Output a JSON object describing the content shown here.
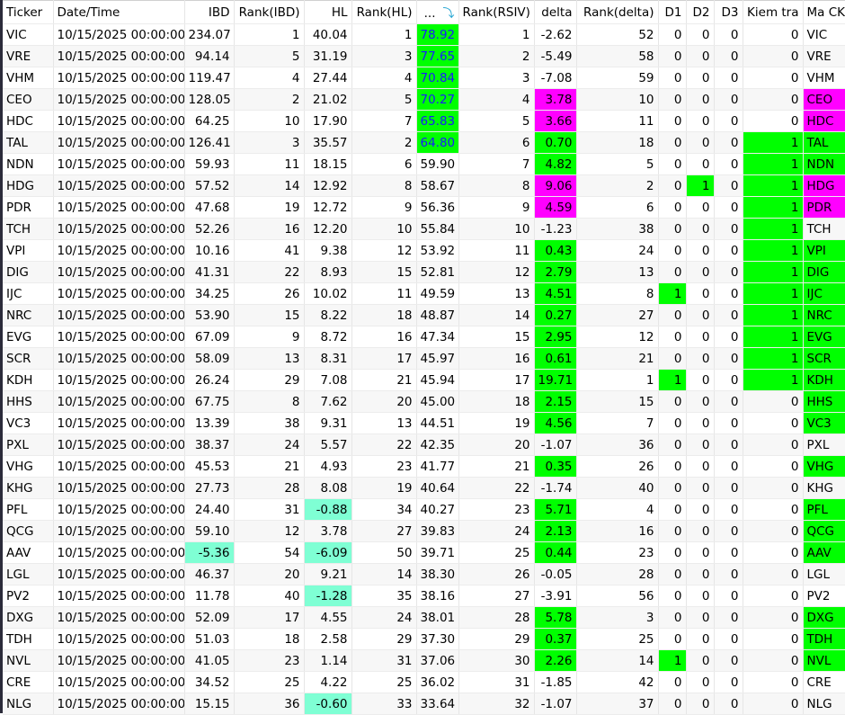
{
  "columns": [
    {
      "label": "Ticker",
      "align": "l",
      "w": 56
    },
    {
      "label": "Date/Time",
      "align": "l",
      "w": 146
    },
    {
      "label": "IBD",
      "align": "r",
      "w": 55
    },
    {
      "label": "Rank(IBD)",
      "align": "r",
      "w": 78
    },
    {
      "label": "HL",
      "align": "r",
      "w": 53
    },
    {
      "label": "Rank(HL)",
      "align": "r",
      "w": 72
    },
    {
      "label": "...",
      "align": "r",
      "w": 47,
      "sort_icon": "sort-descending-icon"
    },
    {
      "label": "Rank(RSIV)",
      "align": "r",
      "w": 84
    },
    {
      "label": "delta",
      "align": "r",
      "w": 47
    },
    {
      "label": "Rank(delta)",
      "align": "r",
      "w": 91
    },
    {
      "label": "D1",
      "align": "r",
      "w": 31
    },
    {
      "label": "D2",
      "align": "r",
      "w": 31
    },
    {
      "label": "D3",
      "align": "r",
      "w": 32
    },
    {
      "label": "Kiem tra",
      "align": "r",
      "w": 67
    },
    {
      "label": "Ma CK",
      "align": "l",
      "w": 47
    }
  ],
  "colors": {
    "green": "#00ff00",
    "greenblue": "#00ff00",
    "magenta": "#ff00ff",
    "aqua": "#7fffd4"
  },
  "rows": [
    {
      "v": [
        "VIC",
        "10/15/2025 00:00:00",
        "234.07",
        "1",
        "40.04",
        "1",
        "78.92",
        "1",
        "-2.62",
        "52",
        "0",
        "0",
        "0",
        "0",
        "VIC"
      ],
      "hl": {
        "6": "greenblue"
      }
    },
    {
      "v": [
        "VRE",
        "10/15/2025 00:00:00",
        "94.14",
        "5",
        "31.19",
        "3",
        "77.65",
        "2",
        "-5.49",
        "58",
        "0",
        "0",
        "0",
        "0",
        "VRE"
      ],
      "hl": {
        "6": "greenblue"
      }
    },
    {
      "v": [
        "VHM",
        "10/15/2025 00:00:00",
        "119.47",
        "4",
        "27.44",
        "4",
        "70.84",
        "3",
        "-7.08",
        "59",
        "0",
        "0",
        "0",
        "0",
        "VHM"
      ],
      "hl": {
        "6": "greenblue"
      }
    },
    {
      "v": [
        "CEO",
        "10/15/2025 00:00:00",
        "128.05",
        "2",
        "21.02",
        "5",
        "70.27",
        "4",
        "3.78",
        "10",
        "0",
        "0",
        "0",
        "0",
        "CEO"
      ],
      "hl": {
        "6": "greenblue",
        "8": "magenta",
        "14": "magenta"
      }
    },
    {
      "v": [
        "HDC",
        "10/15/2025 00:00:00",
        "64.25",
        "10",
        "17.90",
        "7",
        "65.83",
        "5",
        "3.66",
        "11",
        "0",
        "0",
        "0",
        "0",
        "HDC"
      ],
      "hl": {
        "6": "greenblue",
        "8": "magenta",
        "14": "magenta"
      }
    },
    {
      "v": [
        "TAL",
        "10/15/2025 00:00:00",
        "126.41",
        "3",
        "35.57",
        "2",
        "64.80",
        "6",
        "0.70",
        "18",
        "0",
        "0",
        "0",
        "1",
        "TAL"
      ],
      "hl": {
        "6": "greenblue",
        "8": "green",
        "13": "green",
        "14": "green"
      }
    },
    {
      "v": [
        "NDN",
        "10/15/2025 00:00:00",
        "59.93",
        "11",
        "18.15",
        "6",
        "59.90",
        "7",
        "4.82",
        "5",
        "0",
        "0",
        "0",
        "1",
        "NDN"
      ],
      "hl": {
        "8": "green",
        "13": "green",
        "14": "green"
      }
    },
    {
      "v": [
        "HDG",
        "10/15/2025 00:00:00",
        "57.52",
        "14",
        "12.92",
        "8",
        "58.67",
        "8",
        "9.06",
        "2",
        "0",
        "1",
        "0",
        "1",
        "HDG"
      ],
      "hl": {
        "8": "magenta",
        "11": "green",
        "13": "green",
        "14": "magenta"
      }
    },
    {
      "v": [
        "PDR",
        "10/15/2025 00:00:00",
        "47.68",
        "19",
        "12.72",
        "9",
        "56.36",
        "9",
        "4.59",
        "6",
        "0",
        "0",
        "0",
        "1",
        "PDR"
      ],
      "hl": {
        "8": "magenta",
        "13": "green",
        "14": "magenta"
      }
    },
    {
      "v": [
        "TCH",
        "10/15/2025 00:00:00",
        "52.26",
        "16",
        "12.20",
        "10",
        "55.84",
        "10",
        "-1.23",
        "38",
        "0",
        "0",
        "0",
        "1",
        "TCH"
      ],
      "hl": {
        "13": "green"
      }
    },
    {
      "v": [
        "VPI",
        "10/15/2025 00:00:00",
        "10.16",
        "41",
        "9.38",
        "12",
        "53.92",
        "11",
        "0.43",
        "24",
        "0",
        "0",
        "0",
        "1",
        "VPI"
      ],
      "hl": {
        "8": "green",
        "13": "green",
        "14": "green"
      }
    },
    {
      "v": [
        "DIG",
        "10/15/2025 00:00:00",
        "41.31",
        "22",
        "8.93",
        "15",
        "52.81",
        "12",
        "2.79",
        "13",
        "0",
        "0",
        "0",
        "1",
        "DIG"
      ],
      "hl": {
        "8": "green",
        "13": "green",
        "14": "green"
      }
    },
    {
      "v": [
        "IJC",
        "10/15/2025 00:00:00",
        "34.25",
        "26",
        "10.02",
        "11",
        "49.59",
        "13",
        "4.51",
        "8",
        "1",
        "0",
        "0",
        "1",
        "IJC"
      ],
      "hl": {
        "8": "green",
        "10": "green",
        "13": "green",
        "14": "green"
      }
    },
    {
      "v": [
        "NRC",
        "10/15/2025 00:00:00",
        "53.90",
        "15",
        "8.22",
        "18",
        "48.87",
        "14",
        "0.27",
        "27",
        "0",
        "0",
        "0",
        "1",
        "NRC"
      ],
      "hl": {
        "8": "green",
        "13": "green",
        "14": "green"
      }
    },
    {
      "v": [
        "EVG",
        "10/15/2025 00:00:00",
        "67.09",
        "9",
        "8.72",
        "16",
        "47.34",
        "15",
        "2.95",
        "12",
        "0",
        "0",
        "0",
        "1",
        "EVG"
      ],
      "hl": {
        "8": "green",
        "13": "green",
        "14": "green"
      }
    },
    {
      "v": [
        "SCR",
        "10/15/2025 00:00:00",
        "58.09",
        "13",
        "8.31",
        "17",
        "45.97",
        "16",
        "0.61",
        "21",
        "0",
        "0",
        "0",
        "1",
        "SCR"
      ],
      "hl": {
        "8": "green",
        "13": "green",
        "14": "green"
      }
    },
    {
      "v": [
        "KDH",
        "10/15/2025 00:00:00",
        "26.24",
        "29",
        "7.08",
        "21",
        "45.94",
        "17",
        "19.71",
        "1",
        "1",
        "0",
        "0",
        "1",
        "KDH"
      ],
      "hl": {
        "8": "green",
        "10": "green",
        "13": "green",
        "14": "green"
      }
    },
    {
      "v": [
        "HHS",
        "10/15/2025 00:00:00",
        "67.75",
        "8",
        "7.62",
        "20",
        "45.00",
        "18",
        "2.15",
        "15",
        "0",
        "0",
        "0",
        "0",
        "HHS"
      ],
      "hl": {
        "8": "green",
        "14": "green"
      }
    },
    {
      "v": [
        "VC3",
        "10/15/2025 00:00:00",
        "13.39",
        "38",
        "9.31",
        "13",
        "44.51",
        "19",
        "4.56",
        "7",
        "0",
        "0",
        "0",
        "0",
        "VC3"
      ],
      "hl": {
        "8": "green",
        "14": "green"
      }
    },
    {
      "v": [
        "PXL",
        "10/15/2025 00:00:00",
        "38.37",
        "24",
        "5.57",
        "22",
        "42.35",
        "20",
        "-1.07",
        "36",
        "0",
        "0",
        "0",
        "0",
        "PXL"
      ],
      "hl": {}
    },
    {
      "v": [
        "VHG",
        "10/15/2025 00:00:00",
        "45.53",
        "21",
        "4.93",
        "23",
        "41.77",
        "21",
        "0.35",
        "26",
        "0",
        "0",
        "0",
        "0",
        "VHG"
      ],
      "hl": {
        "8": "green",
        "14": "green"
      }
    },
    {
      "v": [
        "KHG",
        "10/15/2025 00:00:00",
        "27.73",
        "28",
        "8.08",
        "19",
        "40.64",
        "22",
        "-1.74",
        "40",
        "0",
        "0",
        "0",
        "0",
        "KHG"
      ],
      "hl": {}
    },
    {
      "v": [
        "PFL",
        "10/15/2025 00:00:00",
        "24.40",
        "31",
        "-0.88",
        "34",
        "40.27",
        "23",
        "5.71",
        "4",
        "0",
        "0",
        "0",
        "0",
        "PFL"
      ],
      "hl": {
        "4": "aqua",
        "8": "green",
        "14": "green"
      }
    },
    {
      "v": [
        "QCG",
        "10/15/2025 00:00:00",
        "59.10",
        "12",
        "3.78",
        "27",
        "39.83",
        "24",
        "2.13",
        "16",
        "0",
        "0",
        "0",
        "0",
        "QCG"
      ],
      "hl": {
        "8": "green",
        "14": "green"
      }
    },
    {
      "v": [
        "AAV",
        "10/15/2025 00:00:00",
        "-5.36",
        "54",
        "-6.09",
        "50",
        "39.71",
        "25",
        "0.44",
        "23",
        "0",
        "0",
        "0",
        "0",
        "AAV"
      ],
      "hl": {
        "2": "aqua",
        "4": "aqua",
        "8": "green",
        "14": "green"
      }
    },
    {
      "v": [
        "LGL",
        "10/15/2025 00:00:00",
        "46.37",
        "20",
        "9.21",
        "14",
        "38.30",
        "26",
        "-0.05",
        "28",
        "0",
        "0",
        "0",
        "0",
        "LGL"
      ],
      "hl": {}
    },
    {
      "v": [
        "PV2",
        "10/15/2025 00:00:00",
        "11.78",
        "40",
        "-1.28",
        "35",
        "38.16",
        "27",
        "-3.91",
        "56",
        "0",
        "0",
        "0",
        "0",
        "PV2"
      ],
      "hl": {
        "4": "aqua"
      }
    },
    {
      "v": [
        "DXG",
        "10/15/2025 00:00:00",
        "52.09",
        "17",
        "4.55",
        "24",
        "38.01",
        "28",
        "5.78",
        "3",
        "0",
        "0",
        "0",
        "0",
        "DXG"
      ],
      "hl": {
        "8": "green",
        "14": "green"
      }
    },
    {
      "v": [
        "TDH",
        "10/15/2025 00:00:00",
        "51.03",
        "18",
        "2.58",
        "29",
        "37.30",
        "29",
        "0.37",
        "25",
        "0",
        "0",
        "0",
        "0",
        "TDH"
      ],
      "hl": {
        "8": "green",
        "14": "green"
      }
    },
    {
      "v": [
        "NVL",
        "10/15/2025 00:00:00",
        "41.05",
        "23",
        "1.14",
        "31",
        "37.06",
        "30",
        "2.26",
        "14",
        "1",
        "0",
        "0",
        "0",
        "NVL"
      ],
      "hl": {
        "8": "green",
        "10": "green",
        "14": "green"
      }
    },
    {
      "v": [
        "CRE",
        "10/15/2025 00:00:00",
        "34.52",
        "25",
        "4.22",
        "25",
        "36.02",
        "31",
        "-1.85",
        "42",
        "0",
        "0",
        "0",
        "0",
        "CRE"
      ],
      "hl": {}
    },
    {
      "v": [
        "NLG",
        "10/15/2025 00:00:00",
        "15.15",
        "36",
        "-0.60",
        "33",
        "33.64",
        "32",
        "-1.07",
        "37",
        "0",
        "0",
        "0",
        "0",
        "NLG"
      ],
      "hl": {
        "4": "aqua"
      }
    }
  ]
}
